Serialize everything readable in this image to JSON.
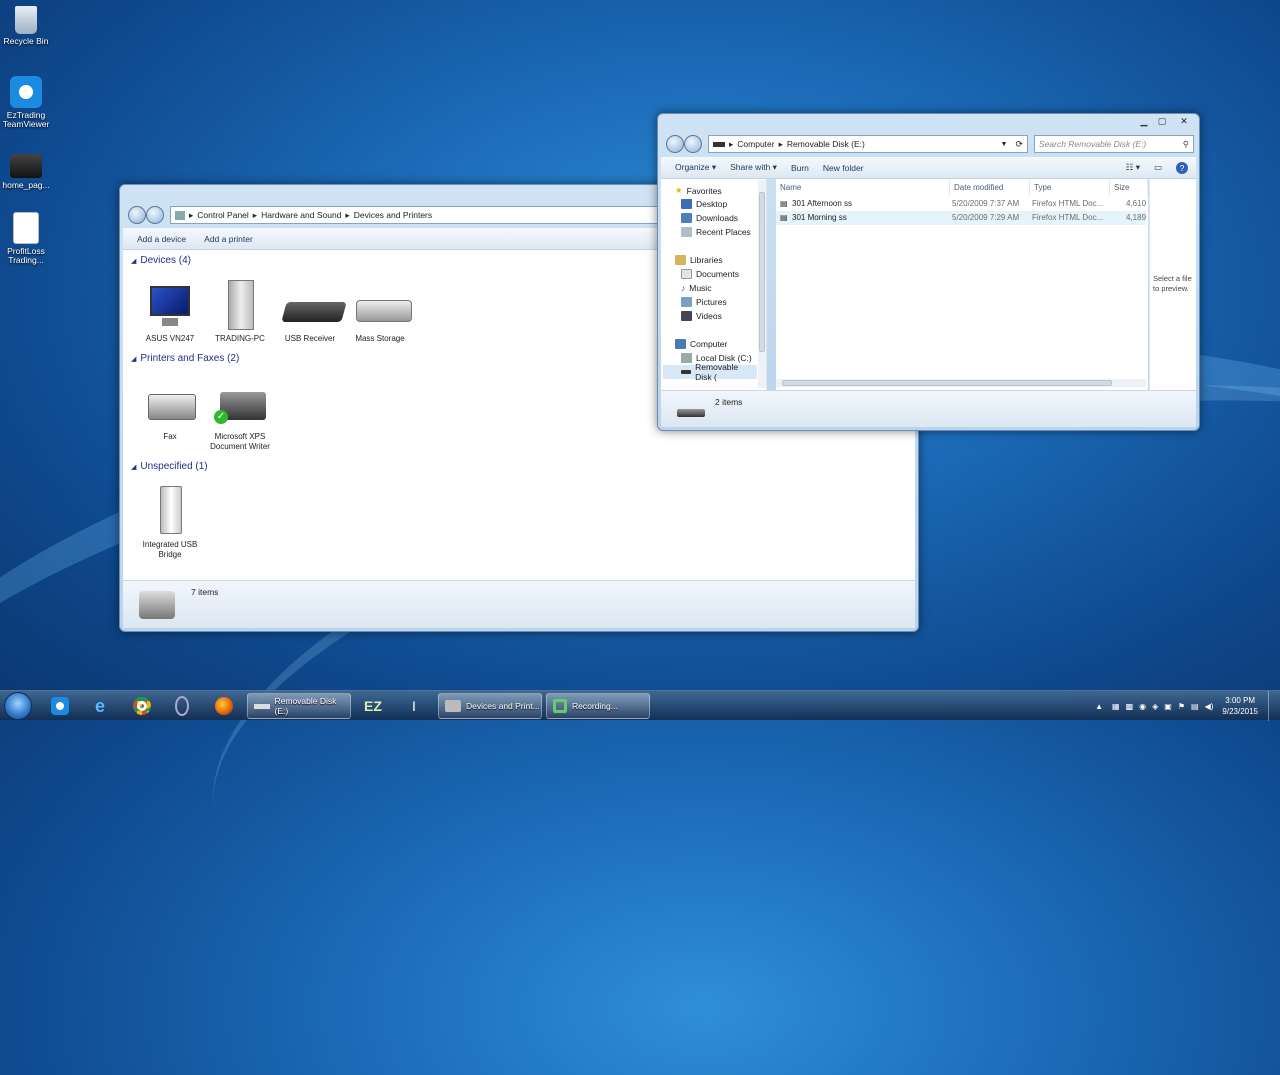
{
  "desktop": {
    "icons": [
      {
        "label": "Recycle Bin"
      },
      {
        "label": "EzTrading TeamViewer"
      },
      {
        "label": "home_pag..."
      },
      {
        "label": "ProfitLoss Trading..."
      }
    ]
  },
  "devices_window": {
    "breadcrumb": [
      "Control Panel",
      "Hardware and Sound",
      "Devices and Printers"
    ],
    "toolbar": {
      "add_device": "Add a device",
      "add_printer": "Add a printer"
    },
    "groups": [
      {
        "title": "Devices (4)",
        "items": [
          "ASUS VN247",
          "TRADING-PC",
          "USB Receiver",
          "Mass Storage"
        ]
      },
      {
        "title": "Printers and Faxes (2)",
        "items": [
          "Fax",
          "Microsoft XPS Document Writer"
        ]
      },
      {
        "title": "Unspecified (1)",
        "items": [
          "Integrated USB Bridge"
        ]
      }
    ],
    "status": "7 items"
  },
  "explorer_window": {
    "address": [
      "Computer",
      "Removable Disk (E:)"
    ],
    "search_placeholder": "Search Removable Disk (E:)",
    "toolbar": {
      "organize": "Organize",
      "share_with": "Share with",
      "burn": "Burn",
      "new_folder": "New folder"
    },
    "nav": {
      "favorites": "Favorites",
      "fav_items": [
        "Desktop",
        "Downloads",
        "Recent Places"
      ],
      "libraries": "Libraries",
      "lib_items": [
        "Documents",
        "Music",
        "Pictures",
        "Videos"
      ],
      "computer": "Computer",
      "comp_items": [
        "Local Disk (C:)",
        "Removable Disk ("
      ]
    },
    "columns": {
      "name": "Name",
      "date": "Date modified",
      "type": "Type",
      "size": "Size"
    },
    "files": [
      {
        "name": "301 Afternoon ss",
        "date": "5/20/2009 7:37 AM",
        "type": "Firefox HTML Doc...",
        "size": "4,610"
      },
      {
        "name": "301 Morning ss",
        "date": "5/20/2009 7:29 AM",
        "type": "Firefox HTML Doc...",
        "size": "4,189"
      }
    ],
    "preview_text": "Select a file to preview.",
    "status": "2 items"
  },
  "taskbar": {
    "buttons": [
      {
        "label": "Removable Disk (E:)"
      },
      {
        "label": "EZ"
      },
      {
        "label": "Devices and Print..."
      },
      {
        "label": "Recording..."
      }
    ],
    "clock_time": "3:00 PM",
    "clock_date": "9/23/2015"
  },
  "colors": {
    "link_blue": "#1e3287",
    "selection": "#cce8ff"
  }
}
